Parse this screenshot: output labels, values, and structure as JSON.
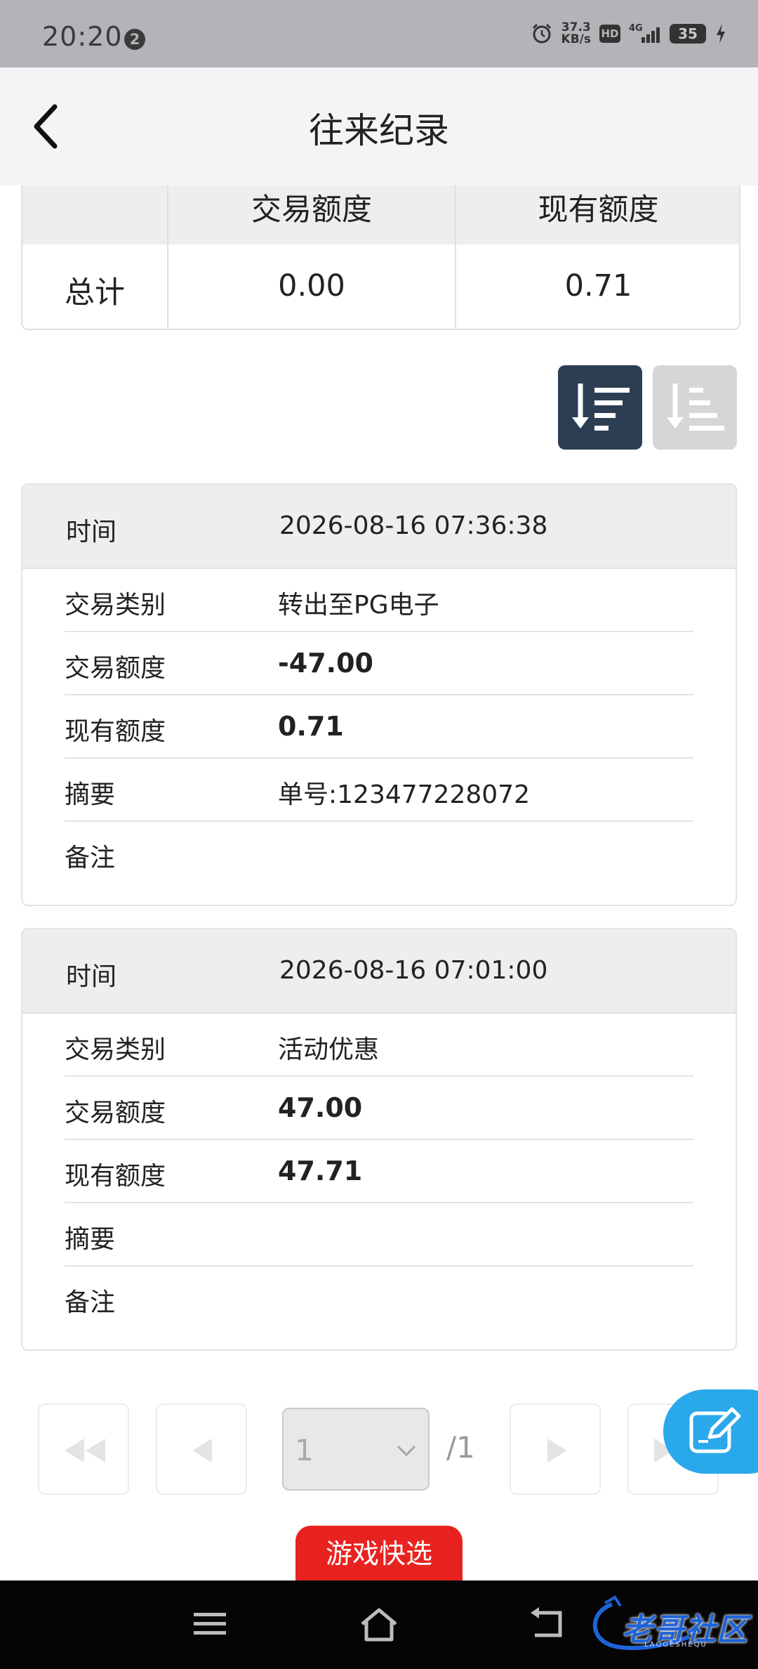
{
  "status_bar": {
    "time": "20:20",
    "notification_count": "2",
    "net_speed_value": "37.3",
    "net_speed_unit": "KB/s",
    "hd_label": "HD",
    "network_label": "4G",
    "battery_level": "35"
  },
  "header": {
    "title": "往来纪录"
  },
  "summary": {
    "columns": [
      "交易额度",
      "现有额度"
    ],
    "row_label": "总计",
    "trade_amount": "0.00",
    "current_balance": "0.71"
  },
  "records": [
    {
      "time_label": "时间",
      "time_value": "2026-08-16 07:36:38",
      "type_label": "交易类别",
      "type_value": "转出至PG电子",
      "amount_label": "交易额度",
      "amount_value": "-47.00",
      "balance_label": "现有额度",
      "balance_value": "0.71",
      "summary_label": "摘要",
      "summary_value": "单号:123477228072",
      "note_label": "备注",
      "note_value": ""
    },
    {
      "time_label": "时间",
      "time_value": "2026-08-16 07:01:00",
      "type_label": "交易类别",
      "type_value": "活动优惠",
      "amount_label": "交易额度",
      "amount_value": "47.00",
      "balance_label": "现有额度",
      "balance_value": "47.71",
      "summary_label": "摘要",
      "summary_value": "",
      "note_label": "备注",
      "note_value": ""
    }
  ],
  "pagination": {
    "current_page": "1",
    "total_pages": "/1"
  },
  "game_quick_select": "游戏快选",
  "watermark": {
    "text": "老哥社区",
    "subtext": "LAOGESHEQU"
  },
  "colors": {
    "sort_active": "#2d3e52",
    "sort_inactive": "#d6d6d6",
    "fab": "#29a8ea",
    "game_button": "#e8231f"
  }
}
